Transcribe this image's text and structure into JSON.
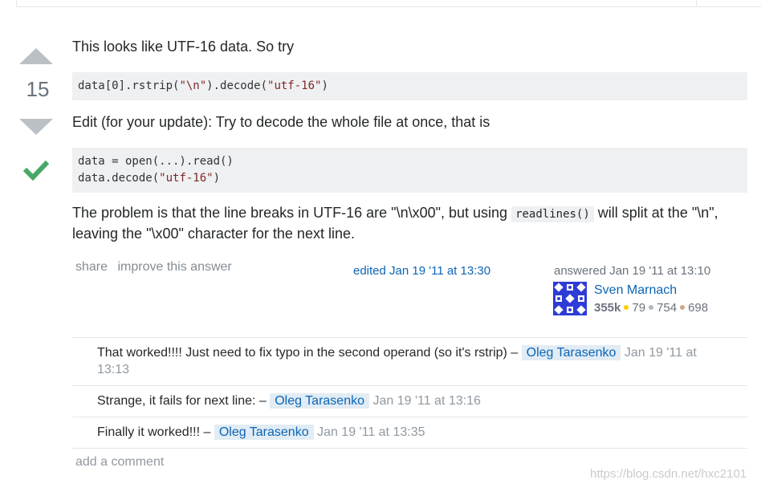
{
  "vote": {
    "score": "15",
    "upvote_icon": "arrow-up-icon",
    "downvote_icon": "arrow-down-icon",
    "accepted_icon": "checkmark-icon",
    "accepted_color": "#48a868"
  },
  "answer": {
    "para1": "This looks like UTF-16 data. So try",
    "code1": {
      "prefix": "data[0].rstrip(",
      "str1": "\"\\n\"",
      "middle": ").decode(",
      "str2": "\"utf-16\"",
      "suffix": ")"
    },
    "para2": "Edit (for your update): Try to decode the whole file at once, that is",
    "code2": {
      "line1": "data = open(...).read()",
      "line2_prefix": "data.decode(",
      "line2_str": "\"utf-16\"",
      "line2_suffix": ")"
    },
    "para3_before": "The problem is that the line breaks in UTF-16 are \"\\n\\x00\", but using ",
    "para3_code": "readlines()",
    "para3_after": " will split at the \"\\n\", leaving the \"\\x00\" character for the next line."
  },
  "post_menu": {
    "share": "share",
    "improve": "improve this answer",
    "edited": "edited Jan 19 '11 at 13:30"
  },
  "user": {
    "answered": "answered Jan 19 '11 at 13:10",
    "name": "Sven Marnach",
    "reputation": "355k",
    "gold": "79",
    "silver": "754",
    "bronze": "698",
    "gold_color": "#ffcc01",
    "silver_color": "#b4b8bc",
    "bronze_color": "#d1a684"
  },
  "comments": [
    {
      "text": "That worked!!!! Just need to fix typo in the second operand (so it's rstrip) – ",
      "user": "Oleg Tarasenko",
      "date": "Jan 19 '11 at 13:13"
    },
    {
      "text": "Strange, it fails for next line: – ",
      "user": "Oleg Tarasenko",
      "date": "Jan 19 '11 at 13:16"
    },
    {
      "text": "Finally it worked!!! – ",
      "user": "Oleg Tarasenko",
      "date": "Jan 19 '11 at 13:35"
    }
  ],
  "add_comment": "add a comment",
  "watermark": "https://blog.csdn.net/hxc2101"
}
